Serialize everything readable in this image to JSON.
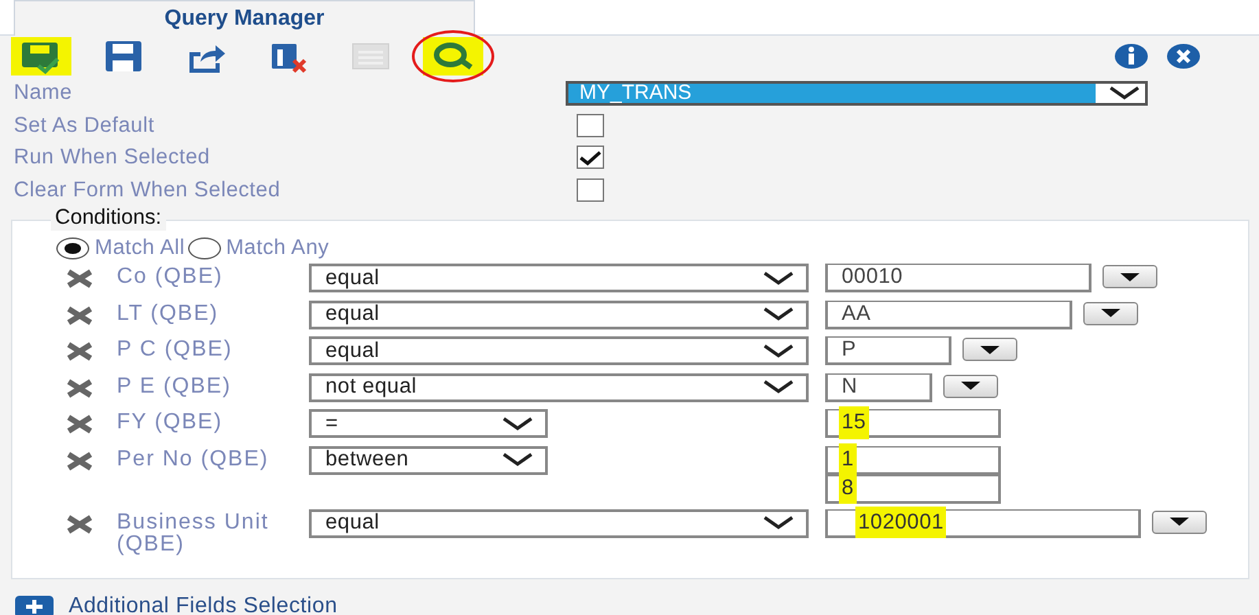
{
  "tab": {
    "label": "Query Manager"
  },
  "toolbar": [
    {
      "kind": "save-check",
      "disabled": false,
      "highlighted": true,
      "circled": false
    },
    {
      "kind": "save",
      "disabled": false,
      "highlighted": false,
      "circled": false
    },
    {
      "kind": "export",
      "disabled": false,
      "highlighted": false,
      "circled": false
    },
    {
      "kind": "delete",
      "disabled": false,
      "highlighted": false,
      "circled": false
    },
    {
      "kind": "notes",
      "disabled": true,
      "highlighted": false,
      "circled": false
    },
    {
      "kind": "search",
      "disabled": false,
      "highlighted": true,
      "circled": true
    }
  ],
  "name": {
    "label": "Name",
    "value": "MY_TRANS",
    "selected": true
  },
  "options": [
    {
      "label": "Set As Default",
      "checked": false
    },
    {
      "label": "Run When Selected",
      "checked": true
    },
    {
      "label": "Clear Form When Selected",
      "checked": false
    }
  ],
  "conditions": {
    "legend": "Conditions:",
    "match": [
      {
        "label": "Match All",
        "selected": true
      },
      {
        "label": "Match Any",
        "selected": false
      }
    ],
    "rows": [
      {
        "label": "Co (QBE)",
        "operator": "equal",
        "values": [
          {
            "text": "00010",
            "highlighted": false
          }
        ],
        "lookup": true
      },
      {
        "label": "LT (QBE)",
        "operator": "equal",
        "values": [
          {
            "text": "AA",
            "highlighted": false
          }
        ],
        "lookup": true
      },
      {
        "label": "P C (QBE)",
        "operator": "equal",
        "values": [
          {
            "text": "P",
            "highlighted": false
          }
        ],
        "lookup": true
      },
      {
        "label": "P E (QBE)",
        "operator": "not equal",
        "values": [
          {
            "text": "N",
            "highlighted": false
          }
        ],
        "lookup": true
      },
      {
        "label": "FY (QBE)",
        "operator": "=",
        "values": [
          {
            "text": "15",
            "highlighted": true
          }
        ],
        "lookup": false
      },
      {
        "label": "Per No (QBE)",
        "operator": "between",
        "values": [
          {
            "text": "1",
            "highlighted": true
          },
          {
            "text": "8",
            "highlighted": true
          }
        ],
        "lookup": false
      },
      {
        "label": "Business Unit (QBE)",
        "operator": "equal",
        "values": [
          {
            "text": "1020001",
            "highlighted": true
          }
        ],
        "lookup": true
      }
    ]
  },
  "additional": {
    "label": "Additional Fields Selection"
  }
}
